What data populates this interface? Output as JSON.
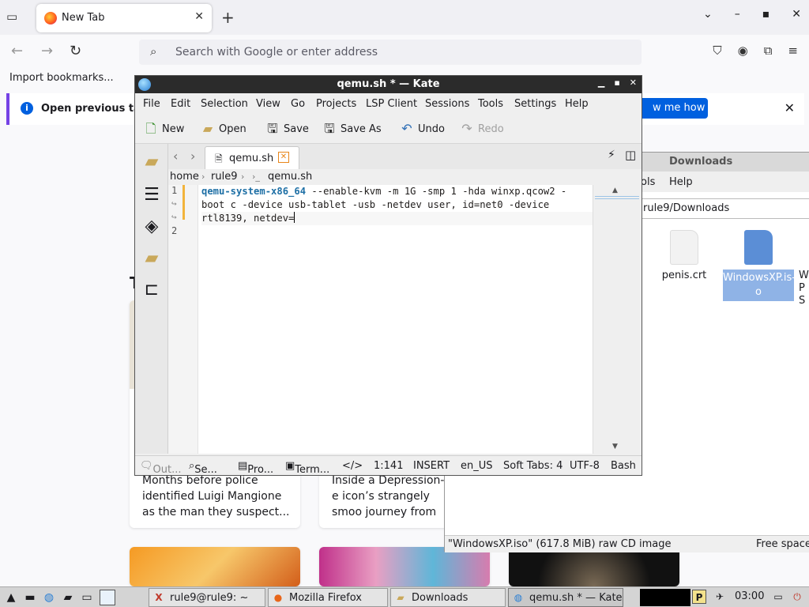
{
  "firefox": {
    "tab_title": "New Tab",
    "search_placeholder": "Search with Google or enter address",
    "bookmark": "Import bookmarks...",
    "notice_text": "Open previous tabs",
    "notice_button": "w me how",
    "stray_heading": "T",
    "cards": [
      {
        "text": "Months before police identified Luigi Mangione as the man they suspect..."
      },
      {
        "text": "Inside a Depression-e icon’s strangely smoo journey from child sta"
      }
    ]
  },
  "downloads": {
    "title": "Downloads",
    "menu": [
      "ols",
      "Help"
    ],
    "path": "rule9/Downloads",
    "files": [
      {
        "name": "penis.crt",
        "icon": "document-icon"
      },
      {
        "name": "WindowsXP.iso",
        "icon": "disc-image-icon",
        "selected": true
      },
      {
        "name": "W P S",
        "icon": "document-icon"
      }
    ],
    "status_left": "\"WindowsXP.iso\" (617.8 MiB) raw CD image",
    "status_right": "Free space"
  },
  "kate": {
    "title": "qemu.sh * — Kate",
    "menu": [
      "File",
      "Edit",
      "Selection",
      "View",
      "Go",
      "Projects",
      "LSP Client",
      "Sessions",
      "Tools",
      "Settings",
      "Help"
    ],
    "toolbar": {
      "new": "New",
      "open": "Open",
      "save": "Save",
      "save_as": "Save As",
      "undo": "Undo",
      "redo": "Redo"
    },
    "doc_tab": "qemu.sh",
    "breadcrumb": [
      "home",
      "rule9",
      "qemu.sh"
    ],
    "gutter": [
      "1",
      "2"
    ],
    "code": {
      "line1_cmd": "qemu-system-x86_64",
      "line1_rest": " --enable-kvm -m 1G -smp 1 -hda winxp.qcow2 -",
      "line1_wrap1": "boot c -device usb-tablet -usb -netdev user, id=net0 -device",
      "line1_wrap2": "rtl8139, netdev="
    },
    "status": {
      "output": "Out...",
      "search": "Se...",
      "projects": "Pro...",
      "terminal": "Term...",
      "position": "1:141",
      "mode": "INSERT",
      "lang": "en_US",
      "tabs": "Soft Tabs: 4",
      "encoding": "UTF-8",
      "syntax": "Bash"
    }
  },
  "taskbar": {
    "tasks": [
      "rule9@rule9: ~",
      "Mozilla Firefox",
      "Downloads",
      "qemu.sh * — Kate"
    ],
    "clock": "03:00"
  }
}
